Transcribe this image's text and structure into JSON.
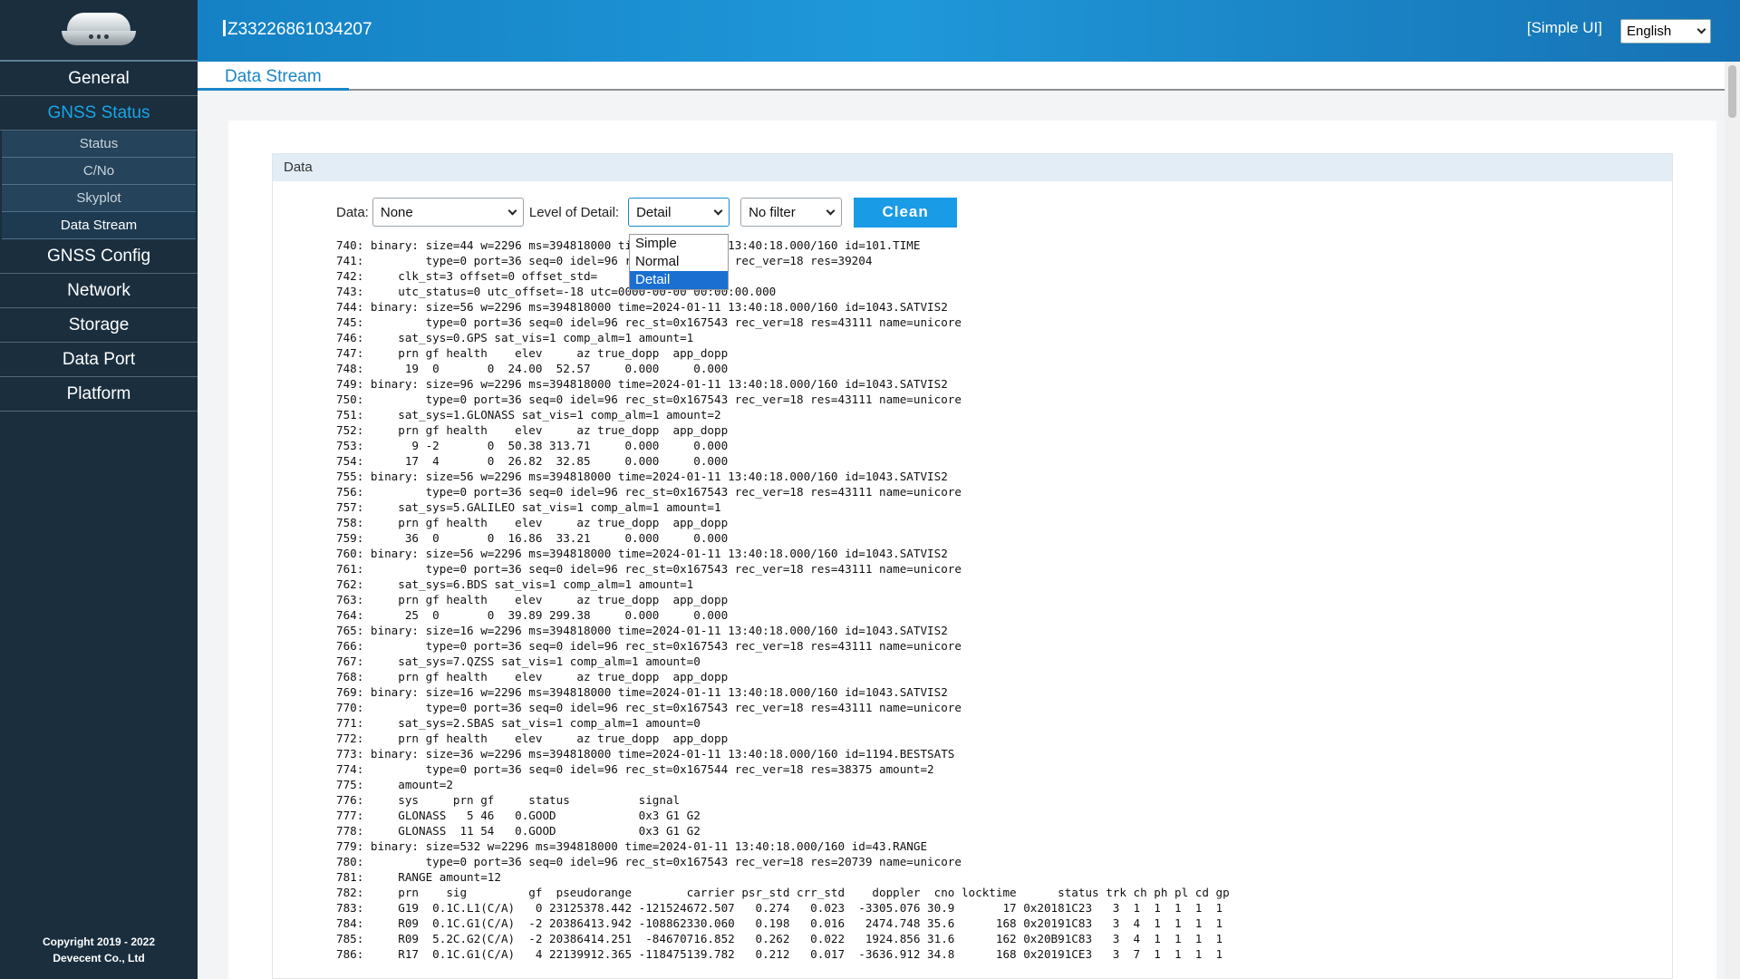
{
  "sidebar": {
    "nav": [
      {
        "label": "General",
        "active": false
      },
      {
        "label": "GNSS Status",
        "active": true
      },
      {
        "label": "GNSS Config",
        "active": false
      },
      {
        "label": "Network",
        "active": false
      },
      {
        "label": "Storage",
        "active": false
      },
      {
        "label": "Data Port",
        "active": false
      },
      {
        "label": "Platform",
        "active": false
      }
    ],
    "gnss_status_sub": [
      {
        "label": "Status"
      },
      {
        "label": "C/No"
      },
      {
        "label": "Skyplot"
      },
      {
        "label": "Data Stream",
        "selected": true
      }
    ],
    "copyright_line1": "Copyright 2019 - 2022",
    "copyright_line2": "Devecent Co., Ltd"
  },
  "header": {
    "device_id": "Z33226861034207",
    "ui_toggle": "[Simple UI]",
    "language": "English"
  },
  "tabs": {
    "active": "Data Stream"
  },
  "panel": {
    "title": "Data",
    "data_label": "Data:",
    "data_value": "None",
    "detail_label": "Level of Detail:",
    "detail_value": "Detail",
    "detail_options": [
      "Simple",
      "Normal",
      "Detail"
    ],
    "filter_value": "No filter",
    "clean_label": "Clean"
  },
  "log_lines": [
    "740: binary: size=44 w=2296 ms=394818000 time=2024-01-11 13:40:18.000/160 id=101.TIME",
    "741:         type=0 port=36 seq=0 idel=96 rec_st=0x167544 rec_ver=18 res=39204",
    "742:     clk_st=3 offset=0 offset_std=       0",
    "743:     utc_status=0 utc_offset=-18 utc=0000-00-00 00:00:00.000",
    "744: binary: size=56 w=2296 ms=394818000 time=2024-01-11 13:40:18.000/160 id=1043.SATVIS2",
    "745:         type=0 port=36 seq=0 idel=96 rec_st=0x167543 rec_ver=18 res=43111 name=unicore",
    "746:     sat_sys=0.GPS sat_vis=1 comp_alm=1 amount=1",
    "747:     prn gf health    elev     az true_dopp  app_dopp",
    "748:      19  0       0  24.00  52.57     0.000     0.000",
    "749: binary: size=96 w=2296 ms=394818000 time=2024-01-11 13:40:18.000/160 id=1043.SATVIS2",
    "750:         type=0 port=36 seq=0 idel=96 rec_st=0x167543 rec_ver=18 res=43111 name=unicore",
    "751:     sat_sys=1.GLONASS sat_vis=1 comp_alm=1 amount=2",
    "752:     prn gf health    elev     az true_dopp  app_dopp",
    "753:       9 -2       0  50.38 313.71     0.000     0.000",
    "754:      17  4       0  26.82  32.85     0.000     0.000",
    "755: binary: size=56 w=2296 ms=394818000 time=2024-01-11 13:40:18.000/160 id=1043.SATVIS2",
    "756:         type=0 port=36 seq=0 idel=96 rec_st=0x167543 rec_ver=18 res=43111 name=unicore",
    "757:     sat_sys=5.GALILEO sat_vis=1 comp_alm=1 amount=1",
    "758:     prn gf health    elev     az true_dopp  app_dopp",
    "759:      36  0       0  16.86  33.21     0.000     0.000",
    "760: binary: size=56 w=2296 ms=394818000 time=2024-01-11 13:40:18.000/160 id=1043.SATVIS2",
    "761:         type=0 port=36 seq=0 idel=96 rec_st=0x167543 rec_ver=18 res=43111 name=unicore",
    "762:     sat_sys=6.BDS sat_vis=1 comp_alm=1 amount=1",
    "763:     prn gf health    elev     az true_dopp  app_dopp",
    "764:      25  0       0  39.89 299.38     0.000     0.000",
    "765: binary: size=16 w=2296 ms=394818000 time=2024-01-11 13:40:18.000/160 id=1043.SATVIS2",
    "766:         type=0 port=36 seq=0 idel=96 rec_st=0x167543 rec_ver=18 res=43111 name=unicore",
    "767:     sat_sys=7.QZSS sat_vis=1 comp_alm=1 amount=0",
    "768:     prn gf health    elev     az true_dopp  app_dopp",
    "769: binary: size=16 w=2296 ms=394818000 time=2024-01-11 13:40:18.000/160 id=1043.SATVIS2",
    "770:         type=0 port=36 seq=0 idel=96 rec_st=0x167543 rec_ver=18 res=43111 name=unicore",
    "771:     sat_sys=2.SBAS sat_vis=1 comp_alm=1 amount=0",
    "772:     prn gf health    elev     az true_dopp  app_dopp",
    "773: binary: size=36 w=2296 ms=394818000 time=2024-01-11 13:40:18.000/160 id=1194.BESTSATS",
    "774:         type=0 port=36 seq=0 idel=96 rec_st=0x167544 rec_ver=18 res=38375 amount=2",
    "775:     amount=2",
    "776:     sys     prn gf     status          signal",
    "777:     GLONASS   5 46   0.GOOD            0x3 G1 G2",
    "778:     GLONASS  11 54   0.GOOD            0x3 G1 G2",
    "779: binary: size=532 w=2296 ms=394818000 time=2024-01-11 13:40:18.000/160 id=43.RANGE",
    "780:         type=0 port=36 seq=0 idel=96 rec_st=0x167543 rec_ver=18 res=20739 name=unicore",
    "781:     RANGE amount=12",
    "782:     prn    sig         gf  pseudorange        carrier psr_std crr_std    doppler  cno locktime      status trk ch ph pl cd gp",
    "783:     G19  0.1C.L1(C/A)   0 23125378.442 -121524672.507   0.274   0.023  -3305.076 30.9       17 0x20181C23   3  1  1  1  1  1",
    "784:     R09  0.1C.G1(C/A)  -2 20386413.942 -108862330.060   0.198   0.016   2474.748 35.6      168 0x20191C83   3  4  1  1  1  1",
    "785:     R09  5.2C.G2(C/A)  -2 20386414.251  -84670716.852   0.262   0.022   1924.856 31.6      162 0x20B91C83   3  4  1  1  1  1",
    "786:     R17  0.1C.G1(C/A)   4 22139912.365 -118475139.782   0.212   0.017  -3636.912 34.8      168 0x20191CE3   3  7  1  1  1  1"
  ]
}
